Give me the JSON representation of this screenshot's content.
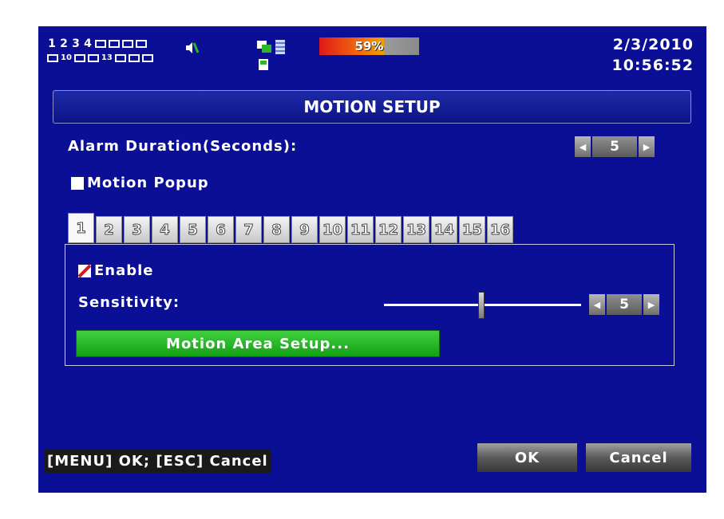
{
  "status": {
    "channels_row1": [
      "1",
      "2",
      "3",
      "4"
    ],
    "channels_row2_labels": [
      "10",
      "13"
    ],
    "hdd_usage": "59%",
    "date": "2/3/2010",
    "time": "10:56:52"
  },
  "title": "MOTION SETUP",
  "alarm_duration": {
    "label": "Alarm Duration(Seconds):",
    "value": "5"
  },
  "motion_popup": {
    "label": "Motion Popup",
    "checked": false
  },
  "channel_tabs": [
    "1",
    "2",
    "3",
    "4",
    "5",
    "6",
    "7",
    "8",
    "9",
    "10",
    "11",
    "12",
    "13",
    "14",
    "15",
    "16"
  ],
  "active_tab": "1",
  "panel": {
    "enable_label": "Enable",
    "enable_checked": true,
    "sensitivity_label": "Sensitivity:",
    "sensitivity_value": "5",
    "motion_area_button": "Motion Area Setup..."
  },
  "footer": {
    "hint": "[MENU] OK; [ESC] Cancel",
    "ok_label": "OK",
    "cancel_label": "Cancel"
  },
  "colors": {
    "background": "#0a0f95",
    "accent_green": "#22b022",
    "hdd_red": "#e01818"
  }
}
